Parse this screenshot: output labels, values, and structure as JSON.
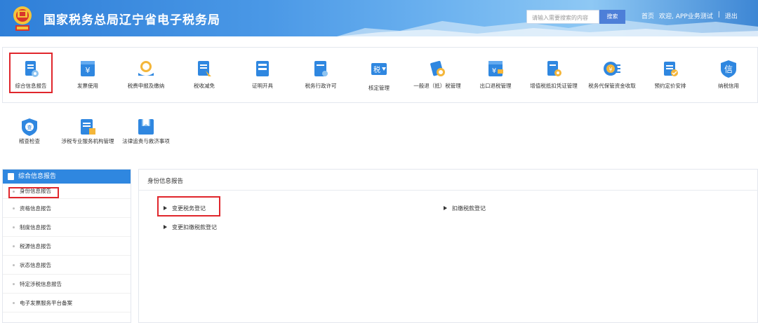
{
  "header": {
    "title": "国家税务总局辽宁省电子税务局",
    "search_placeholder": "请输入需要搜索的内容",
    "search_button": "搜索",
    "links": [
      "首页",
      "欢迎, APP业务测试",
      "|",
      "退出"
    ]
  },
  "menu": {
    "row1": [
      {
        "label": "综合信息报告",
        "icon": "report-icon",
        "selected": true
      },
      {
        "label": "发票使用",
        "icon": "invoice-icon"
      },
      {
        "label": "税费申报及缴纳",
        "icon": "tax-payment-icon"
      },
      {
        "label": "税收减免",
        "icon": "tax-reduction-icon"
      },
      {
        "label": "证明开具",
        "icon": "certificate-icon"
      },
      {
        "label": "税务行政许可",
        "icon": "license-icon"
      },
      {
        "label": "核定管理",
        "icon": "tax-assessment-icon"
      },
      {
        "label": "一般退（抵）税管理",
        "icon": "refund-icon"
      },
      {
        "label": "出口退税管理",
        "icon": "export-refund-icon"
      },
      {
        "label": "增值税抵扣凭证管理",
        "icon": "vat-voucher-icon"
      },
      {
        "label": "税务代保管资金收取",
        "icon": "custody-fund-icon"
      },
      {
        "label": "预约定价安排",
        "icon": "pricing-icon"
      },
      {
        "label": "纳税信用",
        "icon": "credit-icon"
      }
    ],
    "row2": [
      {
        "label": "稽查检查",
        "icon": "inspection-icon"
      },
      {
        "label": "涉税专业服务机构管理",
        "icon": "agency-icon"
      },
      {
        "label": "法律追责与救济事项",
        "icon": "law-icon"
      }
    ]
  },
  "sidebar": {
    "title": "综合信息报告",
    "items": [
      "身份信息报告",
      "资格信息报告",
      "制度信息报告",
      "税源信息报告",
      "状态信息报告",
      "特定涉税信息报告",
      "电子发票服务平台备案"
    ]
  },
  "main": {
    "title": "身份信息报告",
    "links": [
      "变更税务登记",
      "扣缴税款登记",
      "变更扣缴税款登记"
    ]
  },
  "colors": {
    "accent": "#2f87e0",
    "highlight": "#e0262c"
  }
}
